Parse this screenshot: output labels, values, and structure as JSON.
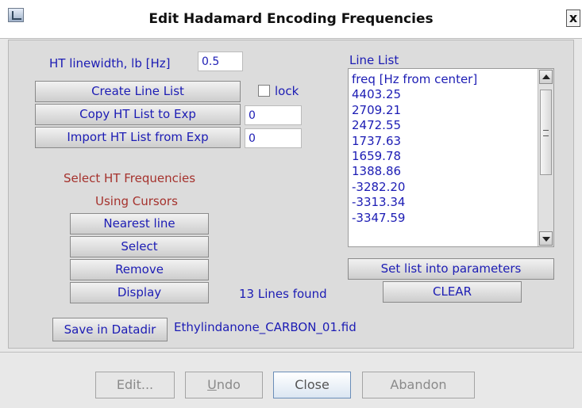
{
  "window": {
    "title": "Edit Hadamard Encoding Frequencies",
    "close_glyph": "x"
  },
  "linewidth": {
    "label": "HT linewidth, lb [Hz]",
    "value": "0.5"
  },
  "buttons": {
    "create_line_list": "Create Line List",
    "copy_ht_list": "Copy HT List to Exp",
    "import_ht_list": "Import HT List from Exp",
    "nearest_line": "Nearest line",
    "select": "Select",
    "remove": "Remove",
    "display": "Display",
    "save_in_datadir": "Save in Datadir",
    "set_list": "Set list into parameters",
    "clear": "CLEAR"
  },
  "lock": {
    "label": "lock",
    "checked": false
  },
  "copy_exp_value": "0",
  "import_exp_value": "0",
  "select_ht": {
    "line1": "Select HT Frequencies",
    "line2": "Using Cursors"
  },
  "lines_found": "13 Lines found",
  "datadir_file": "Ethylindanone_CARBON_01.fid",
  "line_list": {
    "title": "Line List",
    "items": [
      "freq [Hz from center]",
      "4403.25",
      "2709.21",
      "2472.55",
      "1737.63",
      "1659.78",
      "1388.86",
      "-3282.20",
      "-3313.34",
      "-3347.59"
    ]
  },
  "dialog_buttons": {
    "edit": "Edit...",
    "undo_underlined": "U",
    "undo_rest": "ndo",
    "close": "Close",
    "abandon": "Abandon"
  },
  "colors": {
    "label_blue": "#1c1cb4",
    "label_red": "#a5322d",
    "panel_bg": "#dcdcdc"
  }
}
